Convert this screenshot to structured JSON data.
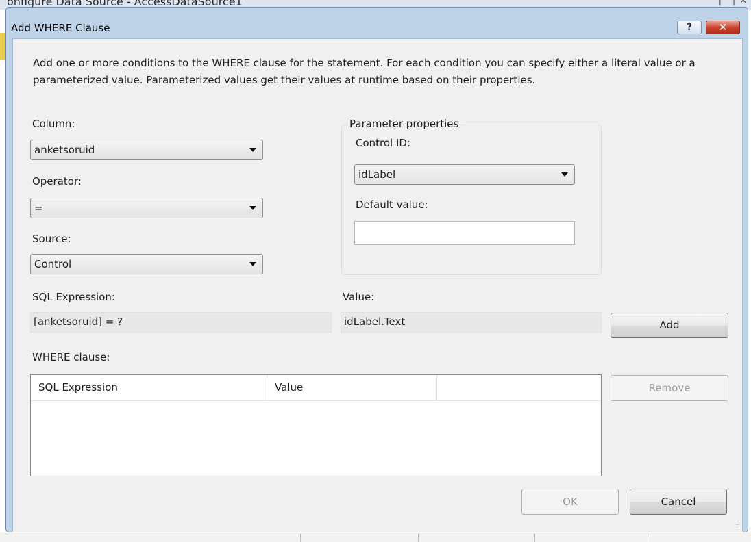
{
  "background_window": {
    "title": "onfigure Data Source - AccessDataSource1"
  },
  "dialog": {
    "title": "Add WHERE Clause",
    "help_label": "?",
    "close_label": "✕"
  },
  "description": "Add one or more conditions to the WHERE clause for the statement. For each condition you can specify either a literal value or a parameterized value. Parameterized values get their values at runtime based on their properties.",
  "column": {
    "label": "Column:",
    "value": "anketsoruid"
  },
  "operator": {
    "label": "Operator:",
    "value": "="
  },
  "source": {
    "label": "Source:",
    "value": "Control"
  },
  "parameter_properties": {
    "legend": "Parameter properties",
    "control_id_label": "Control ID:",
    "control_id_value": "idLabel",
    "default_value_label": "Default value:",
    "default_value": ""
  },
  "sql_expression": {
    "label": "SQL Expression:",
    "value": "[anketsoruid] = ?"
  },
  "value": {
    "label": "Value:",
    "value": "idLabel.Text"
  },
  "buttons": {
    "add": "Add",
    "remove": "Remove",
    "ok": "OK",
    "cancel": "Cancel"
  },
  "where_clause": {
    "label": "WHERE clause:",
    "columns": [
      "SQL Expression",
      "Value",
      ""
    ],
    "rows": []
  }
}
